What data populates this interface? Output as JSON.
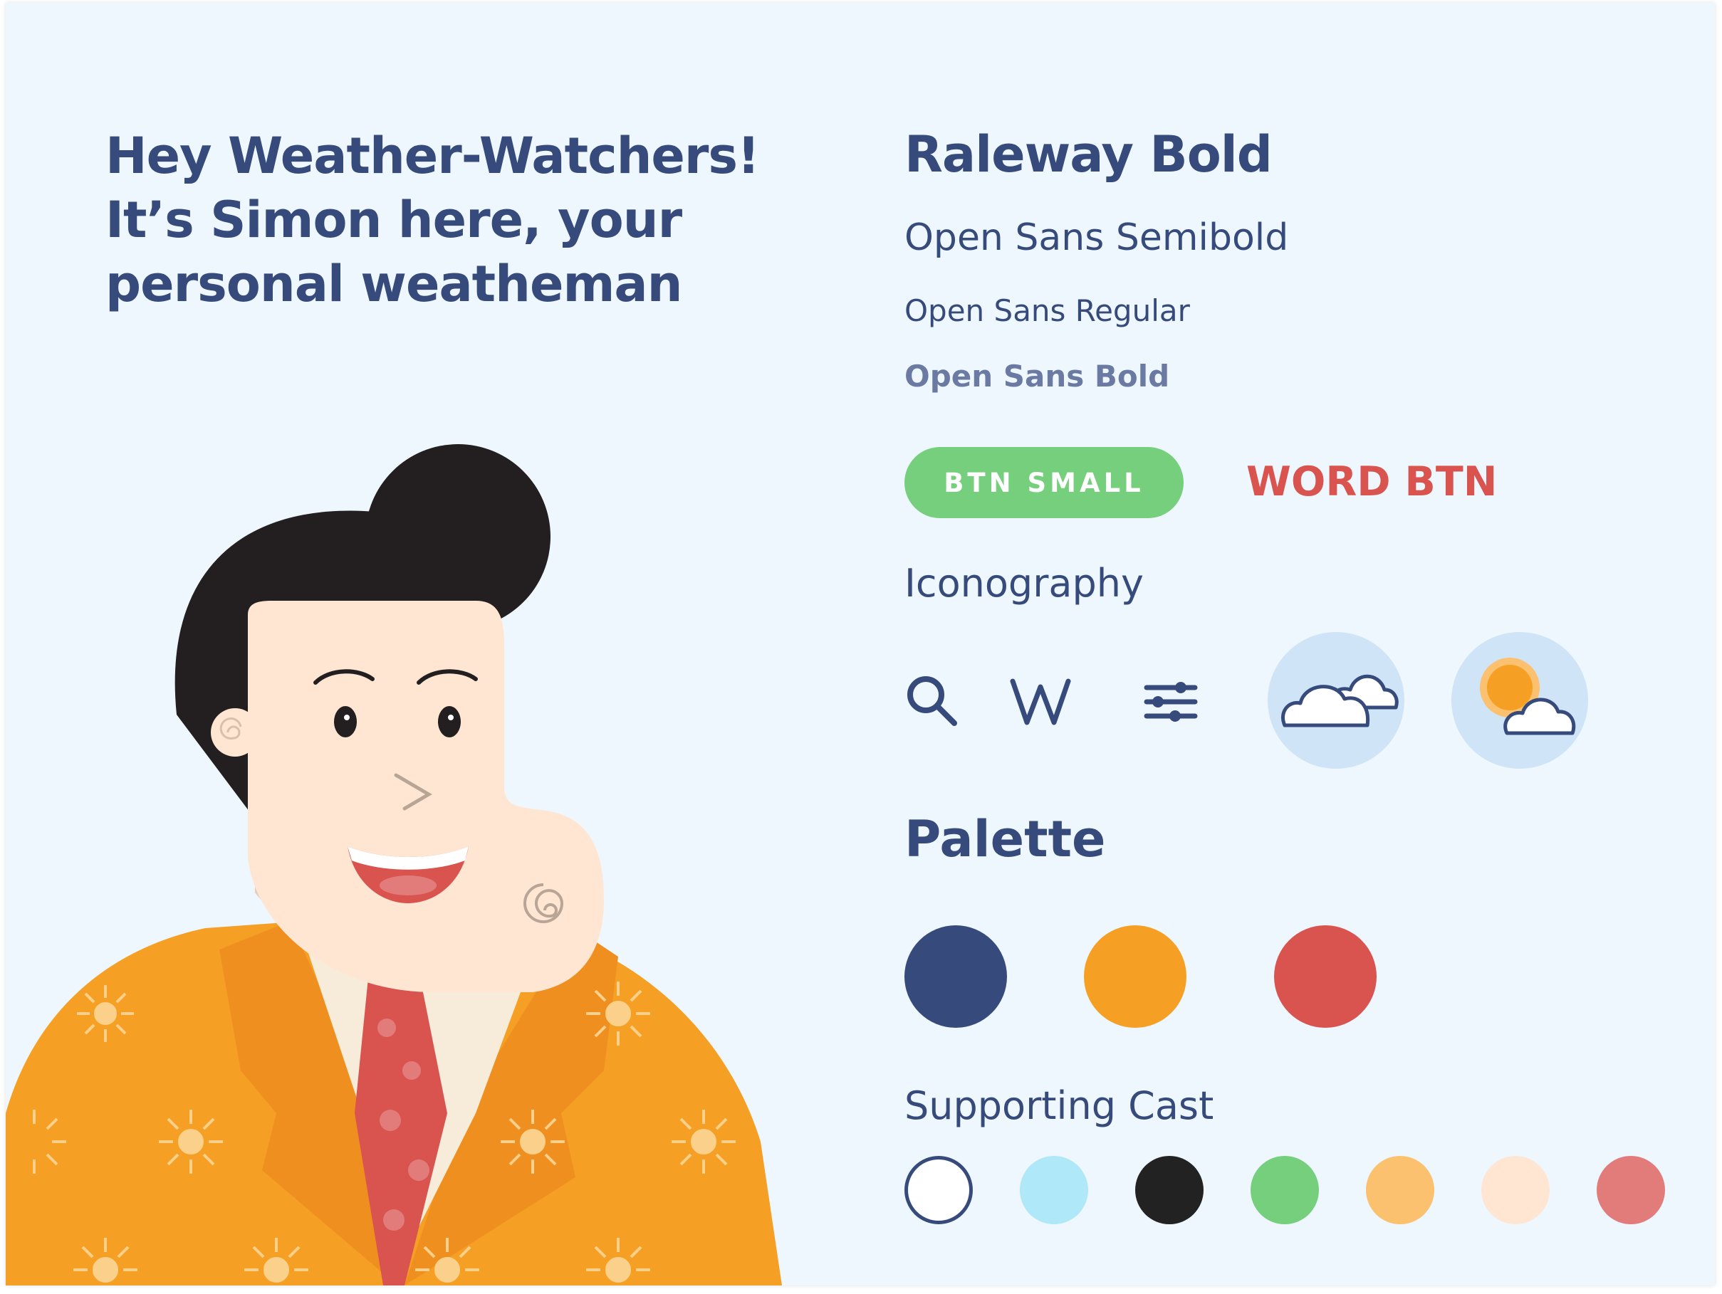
{
  "headline": {
    "lines": [
      "Hey Weather-Watchers!",
      "It’s Simon here, your",
      "personal weatheman"
    ]
  },
  "typography": {
    "raleway_bold": "Raleway Bold",
    "open_sans_semibold": "Open Sans Semibold",
    "open_sans_regular": "Open Sans Regular",
    "open_sans_bold": "Open Sans Bold"
  },
  "buttons": {
    "btn_small": "BTN SMALL",
    "word_btn": "WORD BTN"
  },
  "iconography": {
    "title": "Iconography",
    "icons": [
      "search-icon",
      "w-logo-icon",
      "sliders-icon",
      "cloudy-icon",
      "partly-sunny-icon"
    ]
  },
  "palette": {
    "title": "Palette",
    "colors": [
      "#364b7b",
      "#f5a025",
      "#d9534f"
    ]
  },
  "supporting_cast": {
    "title": "Supporting Cast",
    "colors": [
      "#ffffff",
      "#aee8f9",
      "#222222",
      "#75cf7c",
      "#fbc16e",
      "#fee6d3",
      "#e27c7a"
    ]
  }
}
